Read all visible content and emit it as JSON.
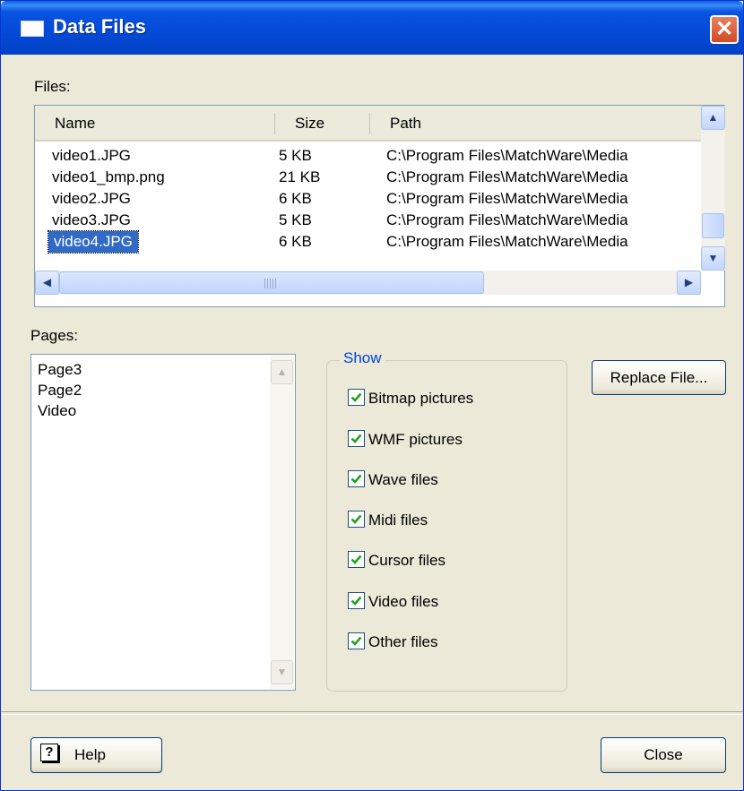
{
  "window": {
    "title": "Data Files",
    "close_glyph": "✕"
  },
  "files": {
    "label": "Files:",
    "columns": [
      "Name",
      "Size",
      "Path"
    ],
    "rows": [
      {
        "name": "video1.JPG",
        "size": "5 KB",
        "path": "C:\\Program Files\\MatchWare\\Media"
      },
      {
        "name": "video1_bmp.png",
        "size": "21 KB",
        "path": "C:\\Program Files\\MatchWare\\Media"
      },
      {
        "name": "video2.JPG",
        "size": "6 KB",
        "path": "C:\\Program Files\\MatchWare\\Media"
      },
      {
        "name": "video3.JPG",
        "size": "5 KB",
        "path": "C:\\Program Files\\MatchWare\\Media"
      },
      {
        "name": "video4.JPG",
        "size": "6 KB",
        "path": "C:\\Program Files\\MatchWare\\Media"
      }
    ],
    "selected_name": "video4.JPG"
  },
  "pages": {
    "label": "Pages:",
    "items": [
      "Page3",
      "Page2",
      "Video"
    ]
  },
  "show": {
    "legend": "Show",
    "options": [
      {
        "label": "Bitmap pictures",
        "checked": true
      },
      {
        "label": "WMF pictures",
        "checked": true
      },
      {
        "label": "Wave files",
        "checked": true
      },
      {
        "label": "Midi files",
        "checked": true
      },
      {
        "label": "Cursor files",
        "checked": true
      },
      {
        "label": "Video files",
        "checked": true
      },
      {
        "label": "Other files",
        "checked": true
      }
    ]
  },
  "buttons": {
    "replace": "Replace File...",
    "help": "Help",
    "help_glyph": "?",
    "close": "Close"
  },
  "icons": {
    "scroll_up": "▲",
    "scroll_down": "▼",
    "scroll_left": "◀",
    "scroll_right": "▶"
  }
}
